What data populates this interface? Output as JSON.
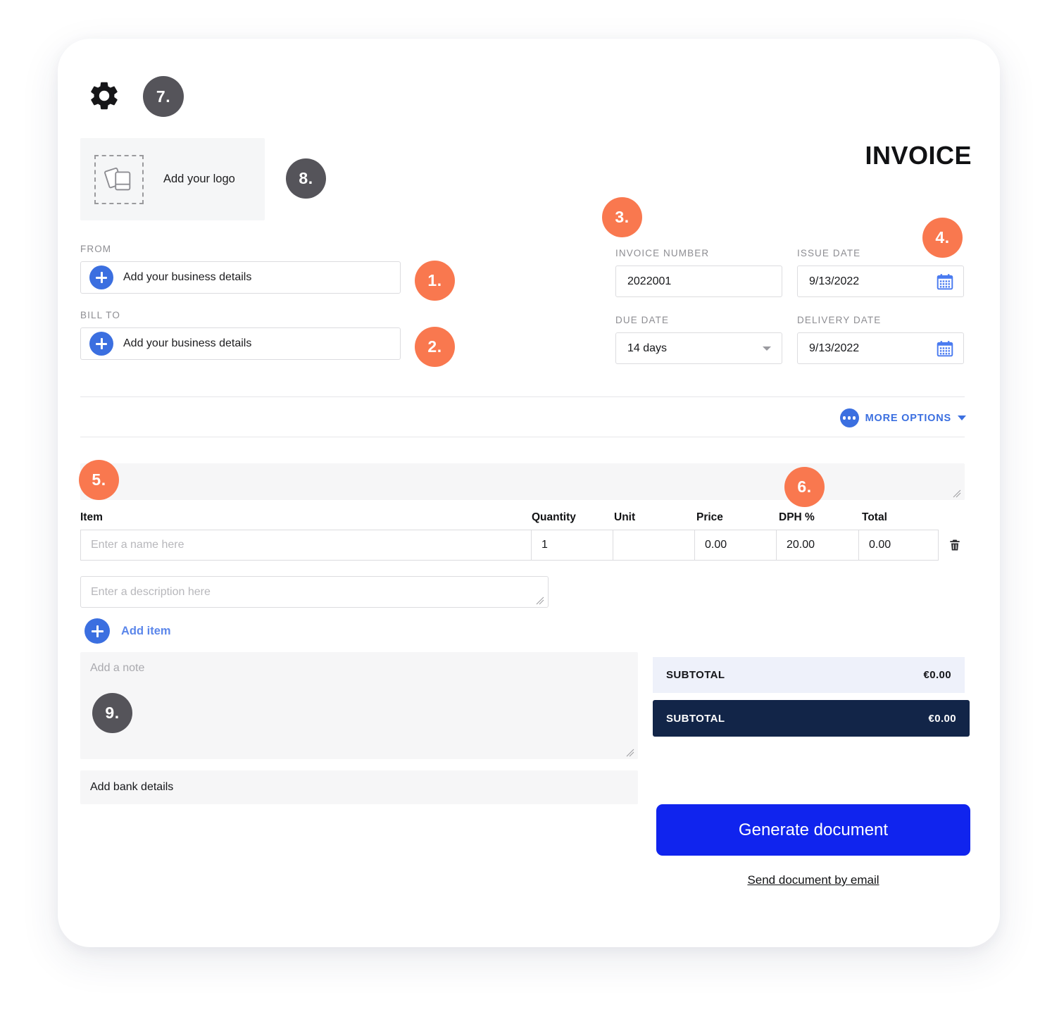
{
  "document": {
    "title": "INVOICE"
  },
  "toolbar": {
    "settings_icon": "gear-icon"
  },
  "logo": {
    "label": "Add your logo",
    "icon": "image-placeholder-icon"
  },
  "parties": {
    "from_label": "FROM",
    "from_value": "Add your business details",
    "bill_to_label": "BILL TO",
    "bill_to_value": "Add your business details"
  },
  "meta": {
    "invoice_number_label": "INVOICE NUMBER",
    "invoice_number_value": "2022001",
    "issue_date_label": "ISSUE DATE",
    "issue_date_value": "9/13/2022",
    "due_date_label": "DUE DATE",
    "due_date_value": "14 days",
    "delivery_date_label": "DELIVERY DATE",
    "delivery_date_value": "9/13/2022"
  },
  "more_options": {
    "label": "MORE OPTIONS",
    "icon": "three-dots-icon",
    "chevron": "chevron-down-icon"
  },
  "items": {
    "columns": [
      "Item",
      "Quantity",
      "Unit",
      "Price",
      "DPH %",
      "Total"
    ],
    "rows": [
      {
        "item_placeholder": "Enter a name here",
        "quantity": "1",
        "unit": "",
        "price": "0.00",
        "dph": "20.00",
        "total": "0.00",
        "delete_icon": "trash-icon"
      }
    ],
    "description_placeholder": "Enter a description here",
    "add_item_label": "Add item"
  },
  "note": {
    "placeholder": "Add a note",
    "bank_label": "Add bank details"
  },
  "totals": [
    {
      "label": "SUBTOTAL",
      "value": "€0.00"
    },
    {
      "label": "SUBTOTAL",
      "value": "€0.00"
    }
  ],
  "actions": {
    "generate_label": "Generate document",
    "send_email_label": "Send document by email"
  },
  "callouts": [
    {
      "n": "1.",
      "color": "orange"
    },
    {
      "n": "2.",
      "color": "orange"
    },
    {
      "n": "3.",
      "color": "orange"
    },
    {
      "n": "4.",
      "color": "orange"
    },
    {
      "n": "5.",
      "color": "orange"
    },
    {
      "n": "6.",
      "color": "orange"
    },
    {
      "n": "7.",
      "color": "gray"
    },
    {
      "n": "8.",
      "color": "gray"
    },
    {
      "n": "9.",
      "color": "gray"
    }
  ],
  "colors": {
    "accent_orange": "#f9784f",
    "badge_gray": "#55545a",
    "link_blue": "#3b6fe0",
    "primary_blue": "#1024ee",
    "total_dark": "#122548",
    "total_light": "#eef1fa"
  }
}
